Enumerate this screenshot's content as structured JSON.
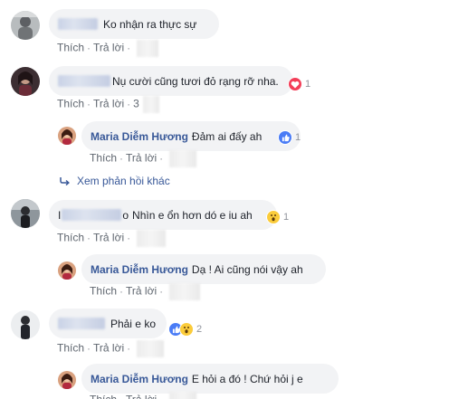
{
  "actions": {
    "like": "Thích",
    "reply": "Trả lời",
    "sep": "·"
  },
  "comments": [
    {
      "text": "Ko nhận ra thực sự"
    },
    {
      "text": "Nụ cười cũng tươi đỏ rạng rỡ nha.",
      "time_partial": "3",
      "reaction_count": "1"
    },
    {
      "name": "Maria Diễm Hương",
      "text": "Đảm ai đấy ah",
      "reaction_count": "1"
    },
    {
      "text_prefix": "I",
      "text_suffix": "o",
      "text": "Nhìn e ổn hơn dó e iu ah",
      "reaction_count": "1"
    },
    {
      "name": "Maria Diễm Hương",
      "text": "Dạ ! Ai cũng nói vậy ah"
    },
    {
      "text": "Phải e ko",
      "reaction_count": "2"
    },
    {
      "name": "Maria Diễm Hương",
      "text": "E hỏi a đó ! Chứ hỏi j e"
    }
  ],
  "more_replies": "Xem phản hồi khác",
  "colors": {
    "bubble": "#f2f3f5",
    "name": "#385898",
    "link": "#606770",
    "heart": "#f33e58",
    "like": "#4a7cf6",
    "wow": "#fbcc3b"
  }
}
